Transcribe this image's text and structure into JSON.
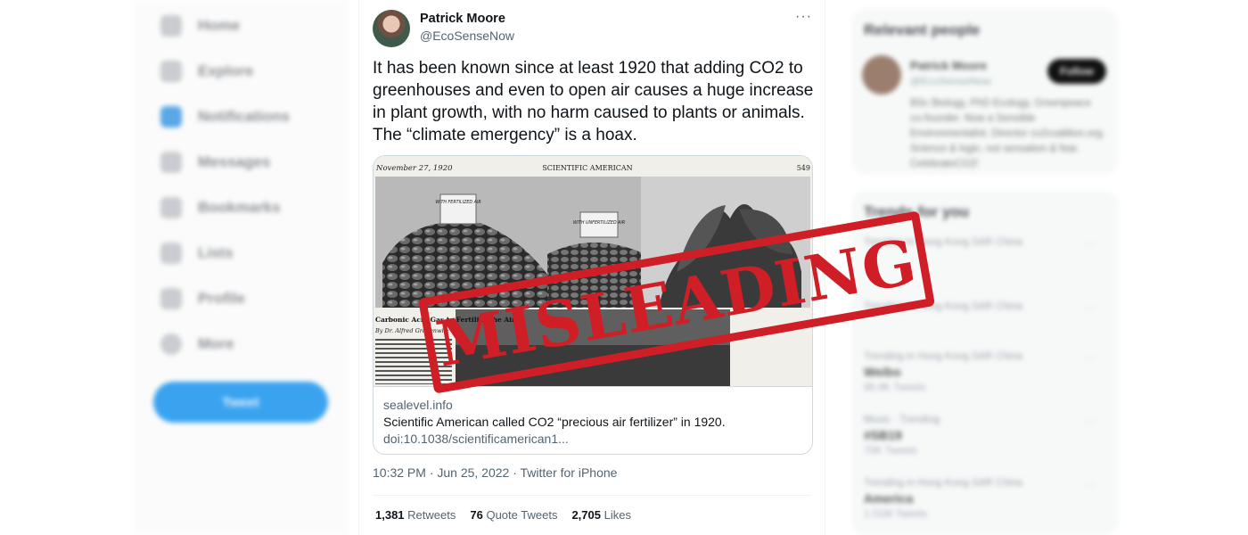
{
  "left_nav": {
    "items": [
      "Home",
      "Explore",
      "Notifications",
      "Messages",
      "Bookmarks",
      "Lists",
      "Profile",
      "More"
    ],
    "tweet_button": "Tweet"
  },
  "tweet": {
    "author_name": "Patrick Moore",
    "author_handle": "@EcoSenseNow",
    "more": "···",
    "text": "It has been known since at least 1920 that adding CO2 to greenhouses and even to open air causes a huge increase in plant growth, with no harm caused to plants or animals. The “climate emergency” is a hoax.",
    "card": {
      "header_date": "November 27, 1920",
      "header_title": "SCIENTIFIC AMERICAN",
      "header_page": "549",
      "sign_1": "WITH FERTILIZED AIR",
      "sign_2": "WITH UNFERTILIZED AIR",
      "article_title": "Carbonic Acid Gas to Fertilize the Air",
      "article_byline": "By Dr. Alfred Gradenwitz",
      "domain": "sealevel.info",
      "title": "Scientific American called CO2 “precious air fertilizer” in 1920.",
      "description": "doi:10.1038/scientificamerican1..."
    },
    "meta": "10:32 PM · Jun 25, 2022 · Twitter for iPhone",
    "stats": {
      "retweets_count": "1,381",
      "retweets_label": "Retweets",
      "quotes_count": "76",
      "quotes_label": "Quote Tweets",
      "likes_count": "2,705",
      "likes_label": "Likes"
    }
  },
  "right": {
    "relevant_title": "Relevant people",
    "person": {
      "name": "Patrick Moore",
      "handle": "@EcoSenseNow",
      "follow": "Follow",
      "bio": "BSc Biology, PhD Ecology, Greenpeace co-founder. Now a Sensible Environmentalist. Director co2coalition.org. Science & logic, not sensation & fear. CelebrateCO2!"
    },
    "trends_title": "Trends for you",
    "trends": [
      {
        "meta": "Trending in Hong Kong SAR China",
        "name": "",
        "count": ""
      },
      {
        "meta": "Trending in Hong Kong SAR China",
        "name": "",
        "count": ""
      },
      {
        "meta": "Trending in Hong Kong SAR China",
        "name": "Weibo",
        "count": "86.9K Tweets"
      },
      {
        "meta": "Music · Trending",
        "name": "#SB19",
        "count": "70K Tweets"
      },
      {
        "meta": "Trending in Hong Kong SAR China",
        "name": "America",
        "count": "1.01M Tweets"
      }
    ]
  },
  "stamp": "MISLEADING"
}
